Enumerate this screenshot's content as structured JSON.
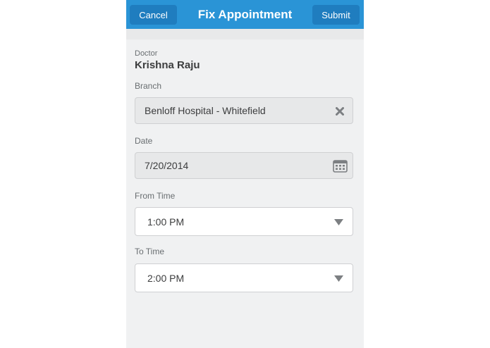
{
  "header": {
    "title": "Fix Appointment",
    "cancel_label": "Cancel",
    "submit_label": "Submit"
  },
  "form": {
    "doctor": {
      "label": "Doctor",
      "value": "Krishna Raju"
    },
    "branch": {
      "label": "Branch",
      "value": "Benloff Hospital - Whitefield",
      "icon": "clear-icon"
    },
    "date": {
      "label": "Date",
      "value": "7/20/2014",
      "icon": "calendar-icon"
    },
    "from_time": {
      "label": "From Time",
      "value": "1:00 PM",
      "icon": "dropdown-arrow-icon"
    },
    "to_time": {
      "label": "To Time",
      "value": "2:00 PM",
      "icon": "dropdown-arrow-icon"
    }
  },
  "colors": {
    "header": "#2a94d6",
    "header_button": "#1f7dbf",
    "background": "#f0f1f2"
  }
}
